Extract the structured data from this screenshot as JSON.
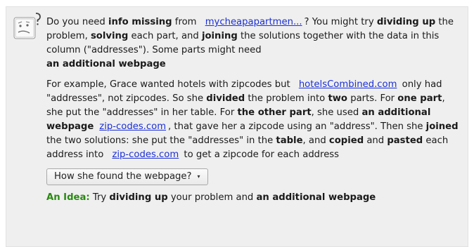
{
  "panel": {
    "para1": {
      "t1": "Do you need ",
      "b1": "info missing",
      "t2": " from ",
      "link": "mycheapapartmen...",
      "t3": "? You might try ",
      "b2": "dividing up",
      "t4": " the problem, ",
      "b3": "solving",
      "t5": " each part, and ",
      "b4": "joining",
      "t6": " the solutions together with the data in this column (\"addresses\"). Some parts might need ",
      "b5": "an additional webpage"
    },
    "para2": {
      "t1": "For example, Grace wanted hotels with zipcodes but ",
      "link1": "hotelsCombined.com",
      "t2": " only had \"addresses\", not zipcodes. So she ",
      "b1": "divided",
      "t3": " the problem into ",
      "b2": "two",
      "t4": " parts. For ",
      "b3": "one part",
      "t5": ", she put the \"addresses\" in her table. For ",
      "b4": "the other part",
      "t6": ", she used ",
      "b5": "an additional webpage",
      "link2": "zip-codes.com",
      "t7": ", that gave her a zipcode using an \"address\". Then she ",
      "b6": "joined",
      "t8": " the two solutions: she put the \"addresses\" in the ",
      "b7": "table",
      "t9": ", and ",
      "b8": "copied",
      "t10": " and ",
      "b9": "pasted",
      "t11": " each address into ",
      "link3": "zip-codes.com",
      "t12": " to get a zipcode for each address"
    },
    "dropdown": {
      "label": "How she found the webpage?",
      "caret": "▾"
    },
    "idea": {
      "label": "An Idea:",
      "t1": " Try ",
      "b1": "dividing up",
      "t2": " your problem and ",
      "b2": "an additional webpage"
    }
  },
  "colors": {
    "link": "#1b2fd6",
    "idea_label": "#2a8a12",
    "panel_bg": "#efefef"
  },
  "icons": {
    "helper": "confused-face-question-icon"
  }
}
